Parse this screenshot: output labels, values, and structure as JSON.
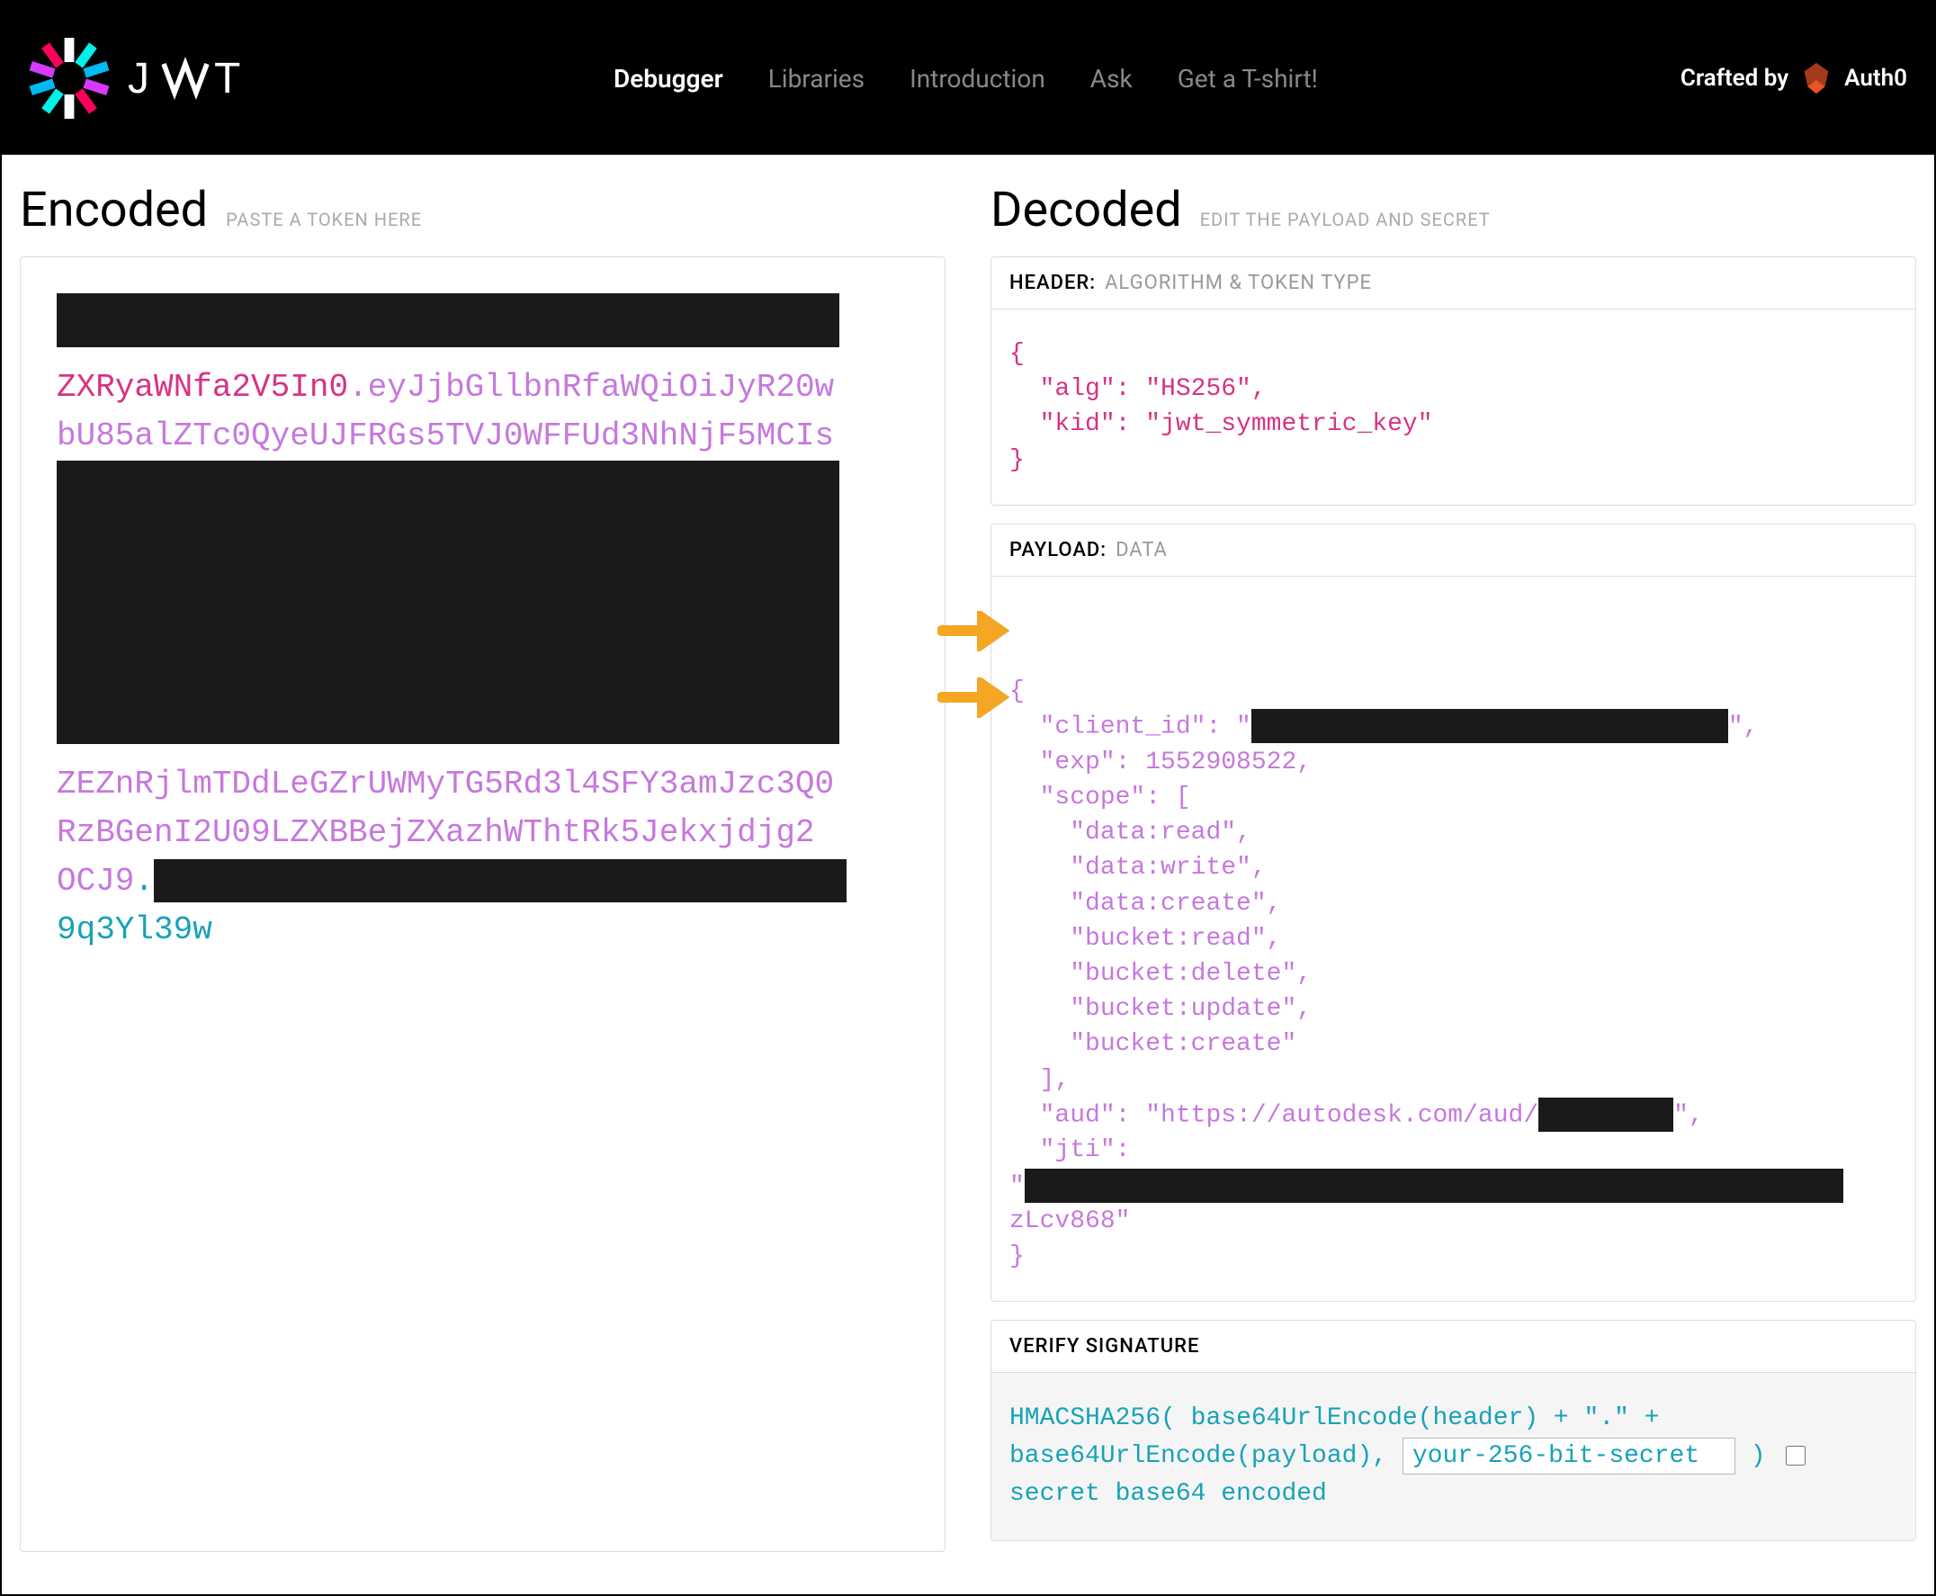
{
  "header": {
    "nav": [
      {
        "label": "Debugger",
        "active": true
      },
      {
        "label": "Libraries",
        "active": false
      },
      {
        "label": "Introduction",
        "active": false
      },
      {
        "label": "Ask",
        "active": false
      },
      {
        "label": "Get a T-shirt!",
        "active": false
      }
    ],
    "crafted_by": "Crafted by",
    "auth0": "Auth0"
  },
  "encoded": {
    "title": "Encoded",
    "subtitle": "PASTE A TOKEN HERE",
    "header_part": "ZXRyaWNfa2V5In0",
    "payload_part1": ".eyJjbGllbnRfaWQiOiJyR20w",
    "payload_part2": "bU85alZTc0QyeUJFRGs5TVJ0WFFUd3NhNjF5MCIs",
    "payload_part3": "ZEZnRjlmTDdLeGZrUWMyTG5Rd3l4SFY3amJzc3Q0",
    "payload_part4": "RzBGenI2U09LZXBBejZXazhWThtRk5Jekxjdjg2",
    "payload_part5": "OCJ9",
    "sig_part": ".",
    "sig_visible": "9q3Yl39w"
  },
  "decoded": {
    "title": "Decoded",
    "subtitle": "EDIT THE PAYLOAD AND SECRET",
    "header": {
      "label": "HEADER:",
      "sublabel": "ALGORITHM & TOKEN TYPE",
      "json": {
        "alg": "HS256",
        "kid": "jwt_symmetric_key"
      }
    },
    "payload": {
      "label": "PAYLOAD:",
      "sublabel": "DATA",
      "client_id_key": "\"client_id\"",
      "exp_key": "\"exp\"",
      "exp_value": 1552908522,
      "scope_key": "\"scope\"",
      "scope_values": [
        "data:read",
        "data:write",
        "data:create",
        "bucket:read",
        "bucket:delete",
        "bucket:update",
        "bucket:create"
      ],
      "aud_key": "\"aud\"",
      "aud_value": "https://autodesk.com/aud/",
      "jti_key": "\"jti\"",
      "jti_suffix": "zLcv868"
    },
    "signature": {
      "label": "VERIFY SIGNATURE",
      "line1": "HMACSHA256(",
      "line2": "base64UrlEncode(header) + \".\" +",
      "line3": "base64UrlEncode(payload),",
      "secret_placeholder": "your-256-bit-secret",
      "line4": ")",
      "checkbox_label": "secret base64 encoded"
    }
  }
}
